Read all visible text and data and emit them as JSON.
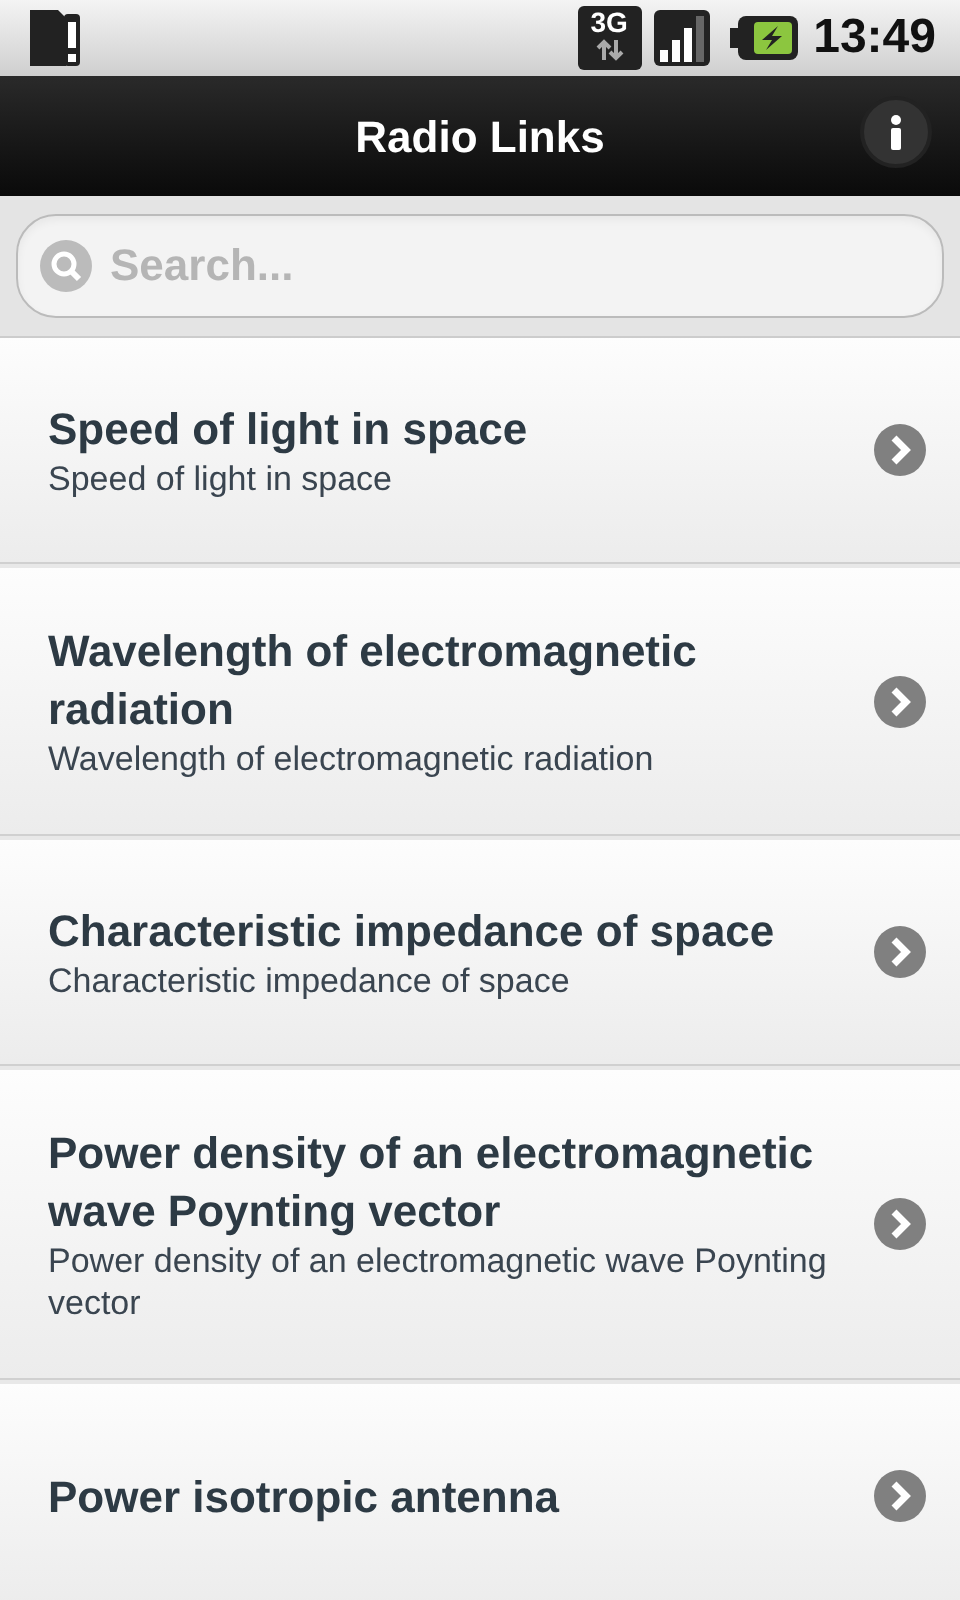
{
  "status_bar": {
    "network": "3G",
    "time": "13:49"
  },
  "header": {
    "title": "Radio Links"
  },
  "search": {
    "placeholder": "Search..."
  },
  "items": [
    {
      "title": "Speed of light in space",
      "subtitle": "Speed of light in space"
    },
    {
      "title": "Wavelength of electromagnetic radiation",
      "subtitle": "Wavelength of electromagnetic radiation"
    },
    {
      "title": "Characteristic impedance of space",
      "subtitle": "Characteristic impedance of space"
    },
    {
      "title": "Power density of an electromagnetic wave Poynting vector",
      "subtitle": "Power density of an electromagnetic wave Poynting vector"
    },
    {
      "title": "Power isotropic antenna"
    }
  ]
}
